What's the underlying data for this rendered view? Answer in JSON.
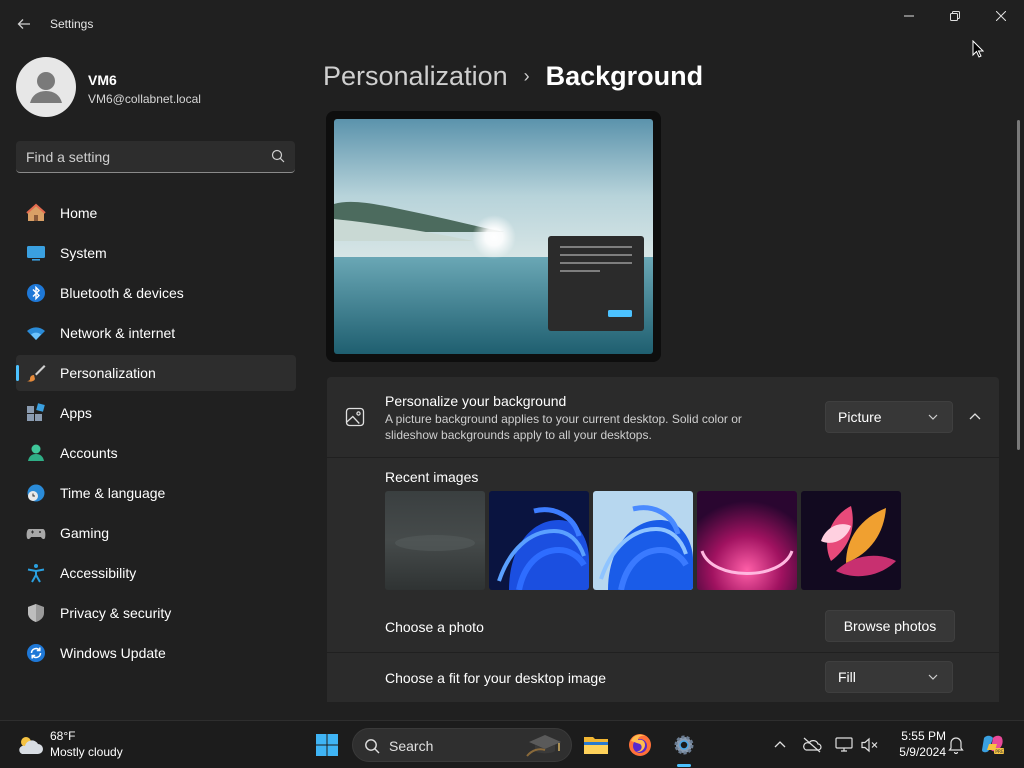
{
  "window": {
    "title": "Settings",
    "back_icon": "arrow-left-icon",
    "min_icon": "minimize-icon",
    "restore_icon": "restore-icon",
    "close_icon": "close-icon"
  },
  "profile": {
    "name": "VM6",
    "email": "VM6@collabnet.local"
  },
  "search": {
    "placeholder": "Find a setting",
    "icon": "search-icon"
  },
  "nav": {
    "items": [
      {
        "label": "Home",
        "icon": "home-icon",
        "active": false
      },
      {
        "label": "System",
        "icon": "system-icon",
        "active": false
      },
      {
        "label": "Bluetooth & devices",
        "icon": "bluetooth-icon",
        "active": false
      },
      {
        "label": "Network & internet",
        "icon": "wifi-icon",
        "active": false
      },
      {
        "label": "Personalization",
        "icon": "brush-icon",
        "active": true
      },
      {
        "label": "Apps",
        "icon": "apps-icon",
        "active": false
      },
      {
        "label": "Accounts",
        "icon": "accounts-icon",
        "active": false
      },
      {
        "label": "Time & language",
        "icon": "globe-clock-icon",
        "active": false
      },
      {
        "label": "Gaming",
        "icon": "gamepad-icon",
        "active": false
      },
      {
        "label": "Accessibility",
        "icon": "accessibility-icon",
        "active": false
      },
      {
        "label": "Privacy & security",
        "icon": "shield-icon",
        "active": false
      },
      {
        "label": "Windows Update",
        "icon": "update-icon",
        "active": false
      }
    ]
  },
  "breadcrumb": {
    "parent": "Personalization",
    "separator": "›",
    "current": "Background"
  },
  "background": {
    "title": "Personalize your background",
    "description": "A picture background applies to your current desktop. Solid color or slideshow backgrounds apply to all your desktops.",
    "type_value": "Picture",
    "recent_label": "Recent images",
    "choose_photo_label": "Choose a photo",
    "browse_label": "Browse photos",
    "fit_label": "Choose a fit for your desktop image",
    "fit_value": "Fill"
  },
  "taskbar": {
    "weather_temp": "68°F",
    "weather_condition": "Mostly cloudy",
    "search_label": "Search",
    "time": "5:55 PM",
    "date": "5/9/2024"
  },
  "colors": {
    "accent": "#4cc2ff",
    "background": "#202020",
    "card": "#2b2b2b"
  }
}
